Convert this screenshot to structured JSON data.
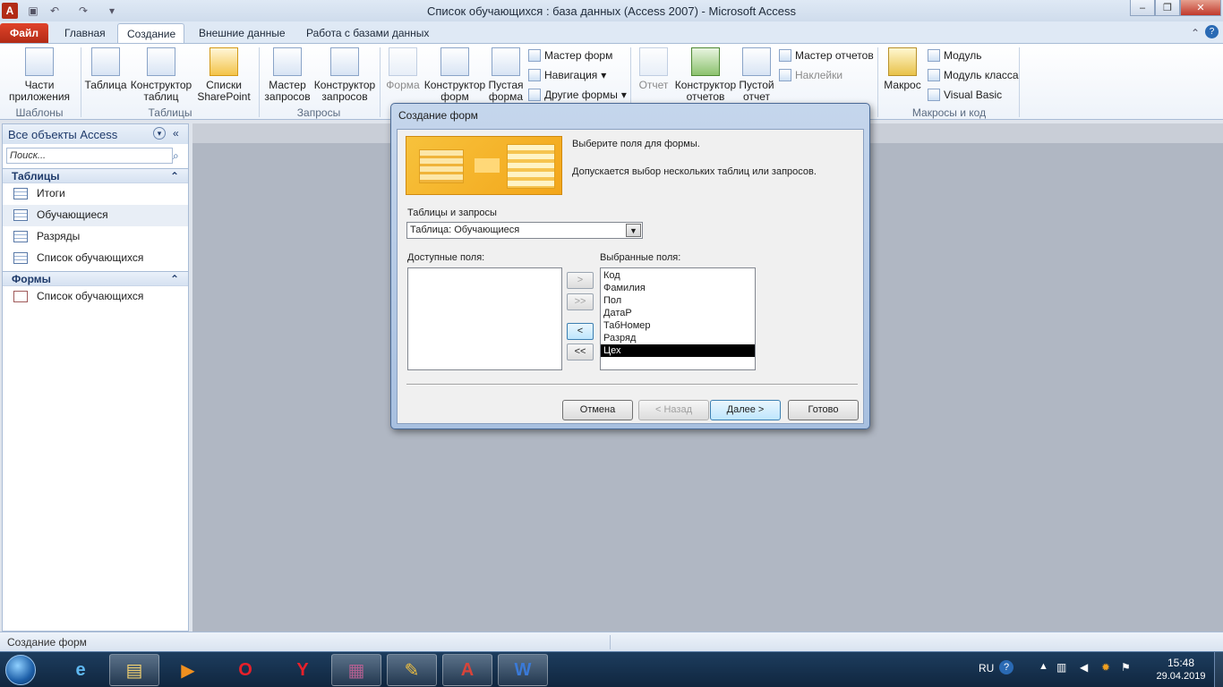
{
  "window": {
    "title": "Список обучающихся : база данных (Access 2007)  -  Microsoft Access"
  },
  "ribbon_tabs": [
    "Файл",
    "Главная",
    "Создание",
    "Внешние данные",
    "Работа с базами данных"
  ],
  "ribbon": {
    "templates": {
      "parts_line1": "Части",
      "parts_line2": "приложения",
      "group": "Шаблоны"
    },
    "tables": {
      "table": "Таблица",
      "designer_line1": "Конструктор",
      "designer_line2": "таблиц",
      "sp_line1": "Списки",
      "sp_line2": "SharePoint",
      "group": "Таблицы"
    },
    "queries": {
      "wizard_line1": "Мастер",
      "wizard_line2": "запросов",
      "designer_line1": "Конструктор",
      "designer_line2": "запросов",
      "group": "Запросы"
    },
    "forms": {
      "form": "Форма",
      "designer_line1": "Конструктор",
      "designer_line2": "форм",
      "blank_line1": "Пустая",
      "blank_line2": "форма",
      "wizard": "Мастер форм",
      "navigation": "Навигация",
      "other": "Другие формы"
    },
    "reports": {
      "report": "Отчет",
      "designer_line1": "Конструктор",
      "designer_line2": "отчетов",
      "blank_line1": "Пустой",
      "blank_line2": "отчет",
      "wizard": "Мастер отчетов",
      "labels": "Наклейки"
    },
    "macros": {
      "macro": "Макрос",
      "module": "Модуль",
      "class_module": "Модуль класса",
      "vb": "Visual Basic",
      "group": "Макросы и код"
    }
  },
  "nav": {
    "header": "Все объекты Access",
    "search_placeholder": "Поиск...",
    "tables_header": "Таблицы",
    "tables": [
      "Итоги",
      "Обучающиеся",
      "Разряды",
      "Список обучающихся"
    ],
    "forms_header": "Формы",
    "forms": [
      "Список обучающихся"
    ]
  },
  "dialog": {
    "title": "Создание форм",
    "intro1": "Выберите поля для формы.",
    "intro2": "Допускается выбор нескольких таблиц или запросов.",
    "tables_label": "Таблицы и запросы",
    "tables_value": "Таблица: Обучающиеся",
    "available_label": "Доступные поля:",
    "selected_label": "Выбранные поля:",
    "selected_fields": [
      "Код",
      "Фамилия",
      "Пол",
      "ДатаР",
      "ТабНомер",
      "Разряд",
      "Цех"
    ],
    "btn_add": ">",
    "btn_add_all": ">>",
    "btn_remove": "<",
    "btn_remove_all": "<<",
    "cancel": "Отмена",
    "back": "< Назад",
    "next": "Далее >",
    "finish": "Готово"
  },
  "status": {
    "text": "Создание форм"
  },
  "tray": {
    "lang": "RU",
    "time": "15:48",
    "date": "29.04.2019"
  }
}
